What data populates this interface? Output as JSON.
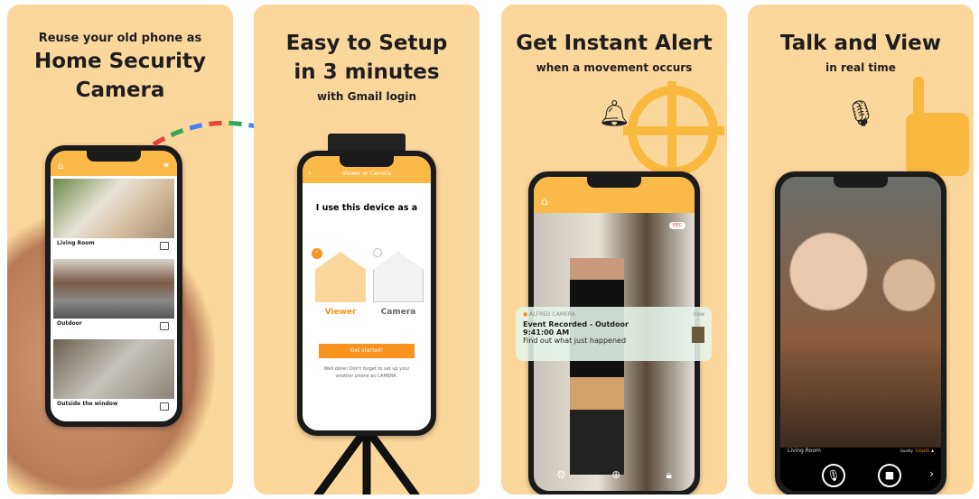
{
  "panels": [
    {
      "subtitle": "Reuse your old phone as",
      "title_line1": "Home Security",
      "title_line2": "Camera",
      "cameras": [
        {
          "name": "Living Room"
        },
        {
          "name": "Outdoor"
        },
        {
          "name": "Outside the window"
        }
      ]
    },
    {
      "title_line1": "Easy to Setup",
      "title_line2": "in 3 minutes",
      "subtitle": "with Gmail login",
      "screen_title": "Viewer or Camera",
      "prompt": "I use this device as a",
      "option_viewer": "Viewer",
      "option_camera": "Camera",
      "button": "Get started!",
      "hint": "Well done! Don't forget to set up your another phone as CAMERA."
    },
    {
      "title": "Get Instant Alert",
      "subtitle": "when a movement occurs",
      "rec_badge": "REC",
      "notification": {
        "app": "ALFRED CAMERA",
        "time": "now",
        "title": "Event Recorded - Outdoor",
        "timestamp": "9:41:00 AM",
        "body": "Find out what just happened"
      }
    },
    {
      "title": "Talk and View",
      "subtitle": "in real time",
      "camera_name": "Living Room",
      "quality_label": "Quality",
      "quality_value": "720pHD"
    }
  ],
  "colors": {
    "background": "#fcd79c",
    "accent": "#f7931e",
    "bar": "#fbb948"
  }
}
